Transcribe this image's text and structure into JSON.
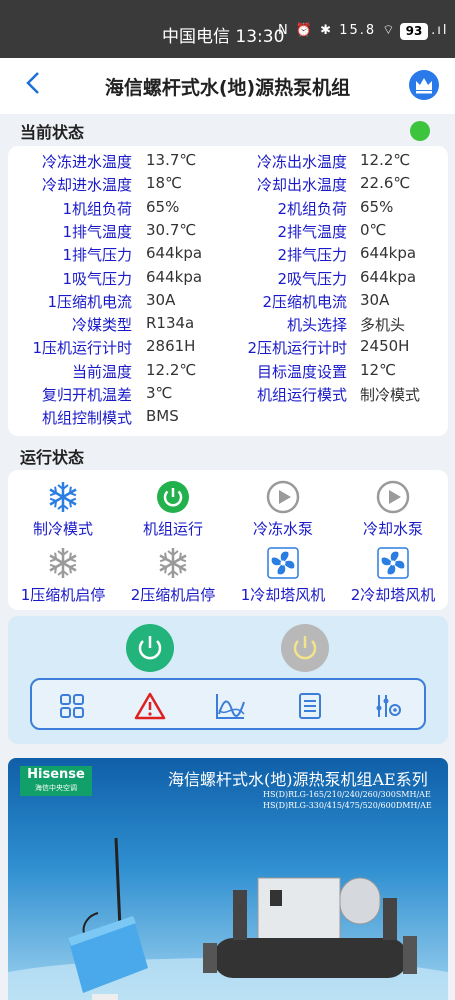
{
  "statusbar": {
    "carrier_time": "中国电信 13:30",
    "icons": "N ⏰ ✱ 15.8 ⌔ 5G .ıl",
    "battery": "93"
  },
  "header": {
    "title": "海信螺杆式水(地)源热泵机组"
  },
  "current_status": {
    "title": "当前状态",
    "rows": [
      {
        "l1": "冷冻进水温度",
        "v1": "13.7℃",
        "l2": "冷冻出水温度",
        "v2": "12.2℃"
      },
      {
        "l1": "冷却进水温度",
        "v1": "18℃",
        "l2": "冷却出水温度",
        "v2": "22.6℃"
      },
      {
        "l1": "1机组负荷",
        "v1": "65%",
        "l2": "2机组负荷",
        "v2": "65%"
      },
      {
        "l1": "1排气温度",
        "v1": "30.7℃",
        "l2": "2排气温度",
        "v2": "0℃"
      },
      {
        "l1": "1排气压力",
        "v1": "644kpa",
        "l2": "2排气压力",
        "v2": "644kpa"
      },
      {
        "l1": "1吸气压力",
        "v1": "644kpa",
        "l2": "2吸气压力",
        "v2": "644kpa"
      },
      {
        "l1": "1压缩机电流",
        "v1": "30A",
        "l2": "2压缩机电流",
        "v2": "30A"
      },
      {
        "l1": "冷媒类型",
        "v1": "R134a",
        "l2": "机头选择",
        "v2": "多机头"
      },
      {
        "l1": "1压机运行计时",
        "v1": "2861H",
        "l2": "2压机运行计时",
        "v2": "2450H"
      },
      {
        "l1": "当前温度",
        "v1": "12.2℃",
        "l2": "目标温度设置",
        "v2": "12℃"
      },
      {
        "l1": "复归开机温差",
        "v1": "3℃",
        "l2": "机组运行模式",
        "v2": "制冷模式"
      },
      {
        "l1": "机组控制模式",
        "v1": "BMS",
        "l2": "",
        "v2": ""
      }
    ]
  },
  "run_status": {
    "title": "运行状态",
    "items": [
      {
        "label": "制冷模式",
        "icon": "snowflake-icon",
        "color": "#2a7de1"
      },
      {
        "label": "机组运行",
        "icon": "power-on-icon",
        "color": "#22b14c"
      },
      {
        "label": "冷冻水泵",
        "icon": "play-icon",
        "color": "#9a9a9a"
      },
      {
        "label": "冷却水泵",
        "icon": "play-icon",
        "color": "#9a9a9a"
      },
      {
        "label": "1压缩机启停",
        "icon": "snowflake-icon",
        "color": "#9a9a9a"
      },
      {
        "label": "2压缩机启停",
        "icon": "snowflake-icon",
        "color": "#9a9a9a"
      },
      {
        "label": "1冷却塔风机",
        "icon": "fan-icon",
        "color": "#2a7de1"
      },
      {
        "label": "2冷却塔风机",
        "icon": "fan-icon",
        "color": "#2a7de1"
      }
    ]
  },
  "controls": {
    "power_on_color": "#22b47a",
    "power_off_color": "#b8b8b8",
    "tools": [
      "grid-icon",
      "warning-icon",
      "chart-icon",
      "list-icon",
      "settings-sliders-icon"
    ]
  },
  "banner": {
    "brand": "Hisense",
    "brand_sub": "海信中央空调",
    "title": "海信螺杆式水(地)源热泵机组AE系列",
    "sub1": "HS(D)RLG-165/210/240/260/300SMH/AE",
    "sub2": "HS(D)RLG-330/415/475/520/600DMH/AE"
  }
}
